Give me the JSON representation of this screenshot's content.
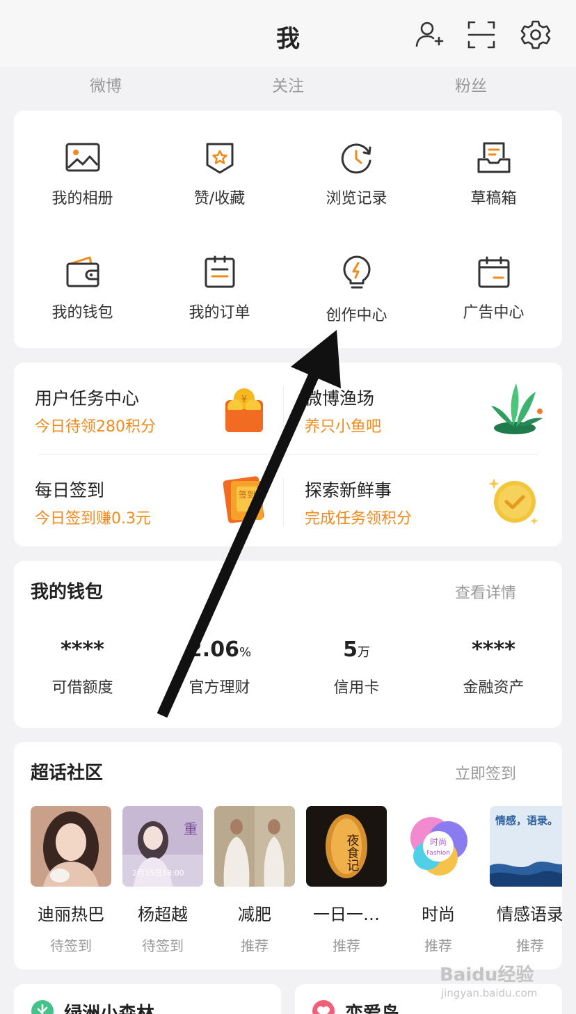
{
  "header": {
    "title": "我"
  },
  "profile_stats": [
    "微博",
    "关注",
    "粉丝"
  ],
  "tools": [
    {
      "label": "我的相册",
      "icon": "photo-album-icon"
    },
    {
      "label": "赞/收藏",
      "icon": "favorite-icon"
    },
    {
      "label": "浏览记录",
      "icon": "history-icon"
    },
    {
      "label": "草稿箱",
      "icon": "drafts-icon"
    },
    {
      "label": "我的钱包",
      "icon": "wallet-icon"
    },
    {
      "label": "我的订单",
      "icon": "orders-icon"
    },
    {
      "label": "创作中心",
      "icon": "creator-center-icon"
    },
    {
      "label": "广告中心",
      "icon": "ad-center-icon"
    }
  ],
  "tasks": [
    {
      "title": "用户任务中心",
      "subtitle": "今日待领280积分"
    },
    {
      "title": "微博渔场",
      "subtitle": "养只小鱼吧"
    },
    {
      "title": "每日签到",
      "subtitle": "今日签到赚0.3元"
    },
    {
      "title": "探索新鲜事",
      "subtitle": "完成任务领积分"
    }
  ],
  "wallet": {
    "title": "我的钱包",
    "link": "查看详情",
    "items": [
      {
        "value": "****",
        "unit": "",
        "label": "可借额度"
      },
      {
        "value": "2.06",
        "unit": "%",
        "label": "官方理财"
      },
      {
        "value": "5",
        "unit": "万",
        "label": "信用卡"
      },
      {
        "value": "****",
        "unit": "",
        "label": "金融资产"
      }
    ]
  },
  "super_topics": {
    "title": "超话社区",
    "link": "立即签到",
    "items": [
      {
        "name": "迪丽热巴",
        "status": "待签到",
        "color": "#c9a08a"
      },
      {
        "name": "杨超越",
        "status": "待签到",
        "color": "#c7b9d3"
      },
      {
        "name": "减肥",
        "status": "推荐",
        "color": "#b9a98f"
      },
      {
        "name": "一日一…",
        "status": "推荐",
        "color": "#1a1410"
      },
      {
        "name": "时尚",
        "status": "推荐",
        "color": "#e86fc0"
      },
      {
        "name": "情感语录",
        "status": "推荐",
        "color": "#dfeaf4"
      }
    ],
    "thumb_texts": {
      "sign_badge": "签到",
      "fashion": "时尚",
      "fashion_en": "Fashion",
      "quote": "情感，语录。",
      "lantern": "夜食记",
      "date": "2月15日18:00"
    }
  },
  "bottom_cards": [
    {
      "title": "绿洲小森林"
    },
    {
      "title": "恋爱岛"
    }
  ],
  "watermark": {
    "main": "Baidu经验",
    "sub": "jingyan.baidu.com"
  },
  "colors": {
    "accent": "#f08a1c",
    "arrow": "#111111"
  }
}
